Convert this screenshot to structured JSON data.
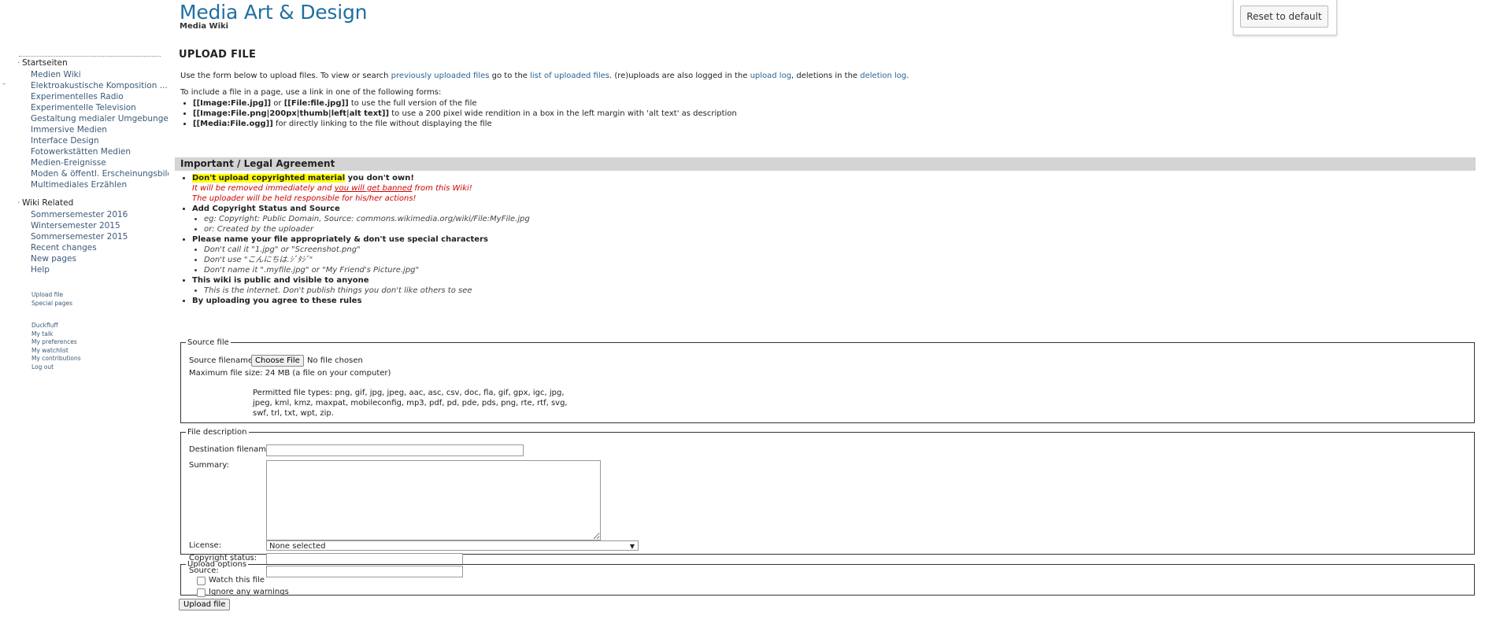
{
  "header": {
    "site_title": "Media Art & Design",
    "site_subtitle": "Media Wiki",
    "reset_label": "Reset to default"
  },
  "sidebar": {
    "group1_title": "Startseiten",
    "group1_items": [
      "Medien Wiki",
      "Elektroakustische Komposition ...",
      "Experimentelles Radio",
      "Experimentelle Television",
      "Gestaltung medialer Umgebungen",
      "Immersive Medien",
      "Interface Design",
      "Fotowerkstätten Medien",
      "Medien-Ereignisse",
      "Moden & öffentl. Erscheinungsbilder",
      "Multimediales Erzählen"
    ],
    "group2_title": "Wiki Related",
    "group2_items": [
      "Sommersemester 2016",
      "Wintersemester 2015",
      "Sommersemester 2015",
      "Recent changes",
      "New pages",
      "Help"
    ],
    "tools": [
      "Upload file",
      "Special pages"
    ],
    "personal": [
      "Duckfluff",
      "My talk",
      "My preferences",
      "My watchlist",
      "My contributions",
      "Log out"
    ]
  },
  "main": {
    "title": "UPLOAD FILE",
    "intro": {
      "t1": "Use the form below to upload files. To view or search ",
      "l1": "previously uploaded files",
      "t2": " go to the ",
      "l2": "list of uploaded files",
      "t3": ". (re)uploads are also logged in the ",
      "l3": "upload log",
      "t4": ", deletions in the ",
      "l4": "deletion log",
      "t5": "."
    },
    "intro2": "To include a file in a page, use a link in one of the following forms:",
    "forms": [
      {
        "a": "[[Image:File.jpg]]",
        "mid": " or ",
        "b": "[[File:file.jpg]]",
        "rest": " to use the full version of the file"
      },
      {
        "a": "[[Image:File.png|200px|thumb|left|alt text]]",
        "rest": " to use a 200 pixel wide rendition in a box in the left margin with 'alt text' as description"
      },
      {
        "a": "[[Media:File.ogg]]",
        "rest": " for directly linking to the file without displaying the file"
      }
    ]
  },
  "legal": {
    "heading": "Important / Legal Agreement",
    "r1_hl": "Don't upload copyrighted material",
    "r1_rest": " you don't own!",
    "r1_red1a": "It will be removed immediately and ",
    "r1_red1u": "you will get banned",
    "r1_red1b": " from this Wiki!",
    "r1_red2": "The uploader will be held responsible for his/her actions!",
    "r2": "Add Copyright Status and Source",
    "r2_subs": [
      "eg: Copyright: Public Domain, Source: commons.wikimedia.org/wiki/File:MyFile.jpg",
      "or: Created by the uploader"
    ],
    "r3": "Please name your file appropriately & don't use special characters",
    "r3_subs": [
      "Don't call it \"1.jpg\" or \"Screenshot.png\"",
      "Don't use \"こんにちは.ｼﾞﾀｼﾞ\"",
      "Don't name it \".myfile.jpg\" or \"My Friend's Picture.jpg\""
    ],
    "r4": "This wiki is public and visible to anyone",
    "r4_subs": [
      "This is the internet. Don't publish things you don't like others to see"
    ],
    "r5": "By uploading you agree to these rules"
  },
  "source": {
    "legend": "Source file",
    "filename_label": "Source filename:",
    "choose_label": "Choose File",
    "no_file": "No file chosen",
    "max_size": "Maximum file size: 24 MB (a file on your computer)",
    "permitted": "Permitted file types: png, gif, jpg, jpeg, aac, asc, csv, doc, fla, gif, gpx, igc, jpg, jpeg, kml, kmz, maxpat, mobileconfig, mp3, pdf, pd, pde, pds, png, rte, rtf, svg, swf, trl, txt, wpt, zip."
  },
  "desc": {
    "legend": "File description",
    "dest_label": "Destination filename:",
    "summary_label": "Summary:",
    "license_label": "License:",
    "license_value": "None selected",
    "copyright_label": "Copyright status:",
    "source_label": "Source:"
  },
  "options": {
    "legend": "Upload options",
    "watch_label": "Watch this file",
    "ignore_label": "Ignore any warnings",
    "upload_label": "Upload file"
  }
}
